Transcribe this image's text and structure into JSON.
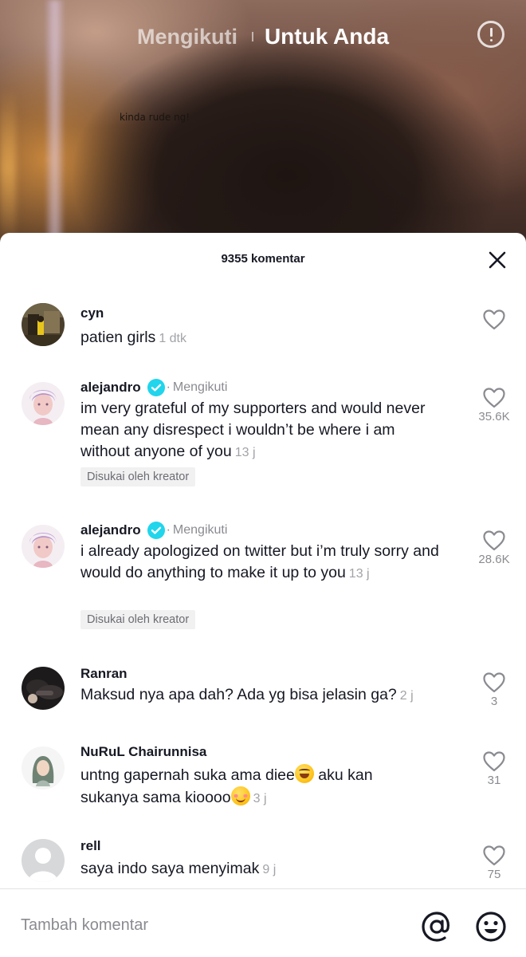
{
  "top_nav": {
    "following_tab": "Mengikuti",
    "for_you_tab": "Untuk Anda",
    "info_icon": "exclamation-circle-icon"
  },
  "video": {
    "caption": "kinda rude ng!"
  },
  "comments_sheet": {
    "count_label": "9355 komentar",
    "close_icon": "close-icon",
    "comments": [
      {
        "username": "cyn",
        "text": "patien girls",
        "time": "1 dtk",
        "likes": ""
      },
      {
        "username": "alejandro",
        "verified": true,
        "following_label": "Mengikuti",
        "text": "im very grateful of my supporters and would never mean any disrespect i wouldn’t be where i am without anyone of you",
        "time": "13 j",
        "badge": "Disukai oleh kreator",
        "likes": "35.6K"
      },
      {
        "username": "alejandro",
        "verified": true,
        "following_label": "Mengikuti",
        "text": "i already apologized on twitter but i’m truly sorry and would do anything to make it up to you",
        "time": "13 j",
        "badge": "Disukai oleh kreator",
        "likes": "28.6K"
      },
      {
        "username": "Ranran",
        "text": "Maksud nya apa dah? Ada yg bisa jelasin ga?",
        "time": "2 j",
        "likes": "3"
      },
      {
        "username": "NuRuL Chairunnisa",
        "text_part1": "untng gapernah suka ama diee",
        "text_part2": " aku kan sukanya sama kioooo",
        "time": "3 j",
        "likes": "31"
      },
      {
        "username": "rell",
        "text": "saya indo saya menyimak",
        "time": "9 j",
        "likes": "75"
      }
    ]
  },
  "input_bar": {
    "placeholder": "Tambah komentar",
    "mention_icon": "at-sign-icon",
    "emoji_icon": "smiley-icon"
  },
  "colors": {
    "verified_badge": "#20d5ec",
    "text_primary": "#161823",
    "text_secondary": "#8a8b91"
  }
}
